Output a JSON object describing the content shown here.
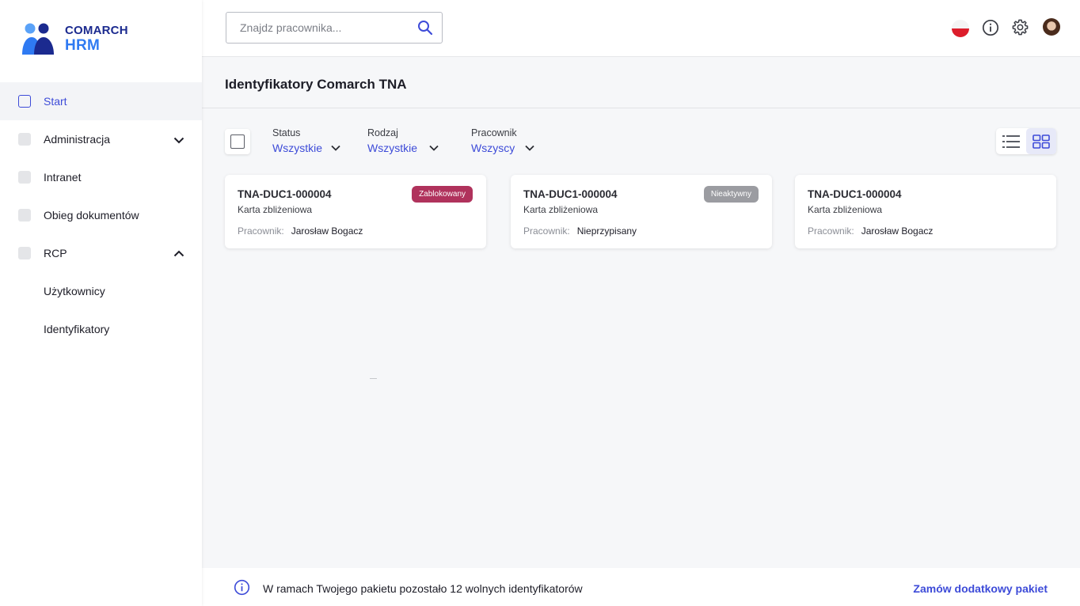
{
  "brand": {
    "line1": "COMARCH",
    "line2": "HRM"
  },
  "sidebar": {
    "items": [
      {
        "label": "Start"
      },
      {
        "label": "Administracja"
      },
      {
        "label": "Intranet"
      },
      {
        "label": "Obieg dokumentów"
      },
      {
        "label": "RCP"
      },
      {
        "label": "Użytkownicy"
      },
      {
        "label": "Identyfikatory"
      }
    ]
  },
  "search": {
    "placeholder": "Znajdz pracownika..."
  },
  "header": {
    "flag_icon": "poland-flag-icon",
    "info_icon": "info-icon",
    "settings_icon": "gear-icon"
  },
  "page": {
    "title": "Identyfikatory Comarch TNA"
  },
  "filters": {
    "status": {
      "label": "Status",
      "value": "Wszystkie"
    },
    "type": {
      "label": "Rodzaj",
      "value": "Wszystkie"
    },
    "employee": {
      "label": "Pracownik",
      "value": "Wszyscy"
    }
  },
  "cards": [
    {
      "id": "TNA-DUC1-000004",
      "type": "Karta zbliżeniowa",
      "employee_label": "Pracownik:",
      "employee": "Jarosław Bogacz",
      "badge": "Zablokowany"
    },
    {
      "id": "TNA-DUC1-000004",
      "type": "Karta zbliżeniowa",
      "employee_label": "Pracownik:",
      "employee": "Nieprzypisany",
      "badge": "Nieaktywny"
    },
    {
      "id": "TNA-DUC1-000004",
      "type": "Karta zbliżeniowa",
      "employee_label": "Pracownik:",
      "employee": "Jarosław Bogacz",
      "badge": ""
    }
  ],
  "footer": {
    "info": "W ramach Twojego pakietu pozostało 12 wolnych identyfikatorów",
    "link": "Zamów dodatkowy pakiet"
  },
  "colors": {
    "accent": "#3d4bd8",
    "blocked": "#b0325c",
    "inactive": "#9b9ca1",
    "brand_dark": "#1b2a8f",
    "brand_light": "#2f7af2"
  }
}
